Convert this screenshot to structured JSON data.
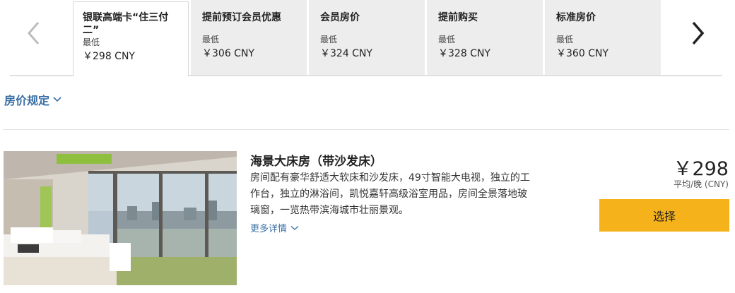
{
  "carousel": {
    "prev_icon": "chevron-left-icon",
    "next_icon": "chevron-right-icon",
    "tabs": [
      {
        "name": "银联高端卡“住三付二”",
        "low_label": "最低",
        "price": "￥298 CNY",
        "active": true
      },
      {
        "name": "提前预订会员优惠",
        "low_label": "最低",
        "price": "￥306 CNY",
        "active": false
      },
      {
        "name": "会员房价",
        "low_label": "最低",
        "price": "￥324 CNY",
        "active": false
      },
      {
        "name": "提前购买",
        "low_label": "最低",
        "price": "￥328 CNY",
        "active": false
      },
      {
        "name": "标准房价",
        "low_label": "最低",
        "price": "￥360 CNY",
        "active": false
      }
    ]
  },
  "rate_rules": {
    "label": "房价规定",
    "icon": "chevron-down-icon"
  },
  "room": {
    "title": "海景大床房（带沙发床）",
    "description": "房间配有豪华舒适大软床和沙发床，49寸智能大电视，独立的工作台，独立的淋浴间，凯悦嘉轩高级浴室用品，房间全景落地玻璃窗，一览热带滨海城市壮丽景观。",
    "more_label": "更多详情",
    "price": "￥298",
    "price_unit": "平均/晚 (CNY)",
    "select_label": "选择"
  },
  "colors": {
    "accent_blue": "#3a6fa5",
    "select_button": "#f6b21a",
    "tab_inactive": "#ededed"
  }
}
